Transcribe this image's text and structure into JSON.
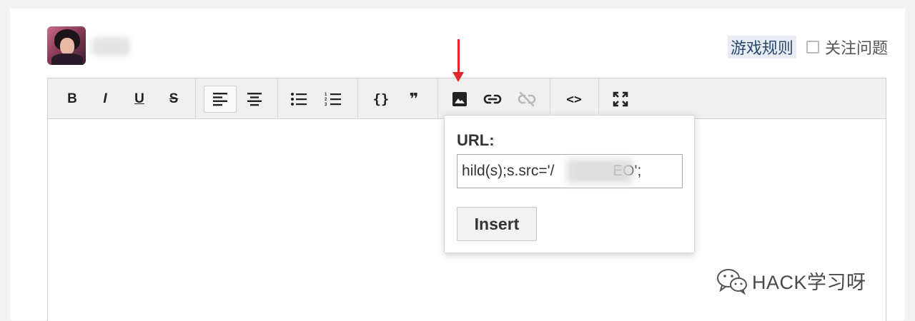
{
  "header": {
    "username": "",
    "game_rules_link": "游戏规则",
    "follow_question_link": "关注问题"
  },
  "toolbar": {
    "buttons": [
      {
        "name": "bold",
        "label": "B"
      },
      {
        "name": "italic",
        "label": "I"
      },
      {
        "name": "underline",
        "label": "U"
      },
      {
        "name": "strikethrough",
        "label": "S"
      },
      {
        "name": "align-left"
      },
      {
        "name": "align-center"
      },
      {
        "name": "bulleted-list"
      },
      {
        "name": "numbered-list"
      },
      {
        "name": "code-block",
        "label": "{}"
      },
      {
        "name": "blockquote",
        "label": "❞"
      },
      {
        "name": "insert-image"
      },
      {
        "name": "insert-link"
      },
      {
        "name": "remove-link"
      },
      {
        "name": "source-code",
        "label": "<>"
      },
      {
        "name": "fullscreen"
      }
    ],
    "active": [
      "align-left"
    ],
    "disabled": [
      "remove-link"
    ]
  },
  "image_popover": {
    "url_label": "URL:",
    "url_value": "hild(s);s.src='/              EO';",
    "insert_label": "Insert"
  },
  "watermark": {
    "text": "HACK学习呀"
  },
  "colors": {
    "annotation_arrow": "#e0282a",
    "toolbar_bg": "#f0f0f0"
  }
}
